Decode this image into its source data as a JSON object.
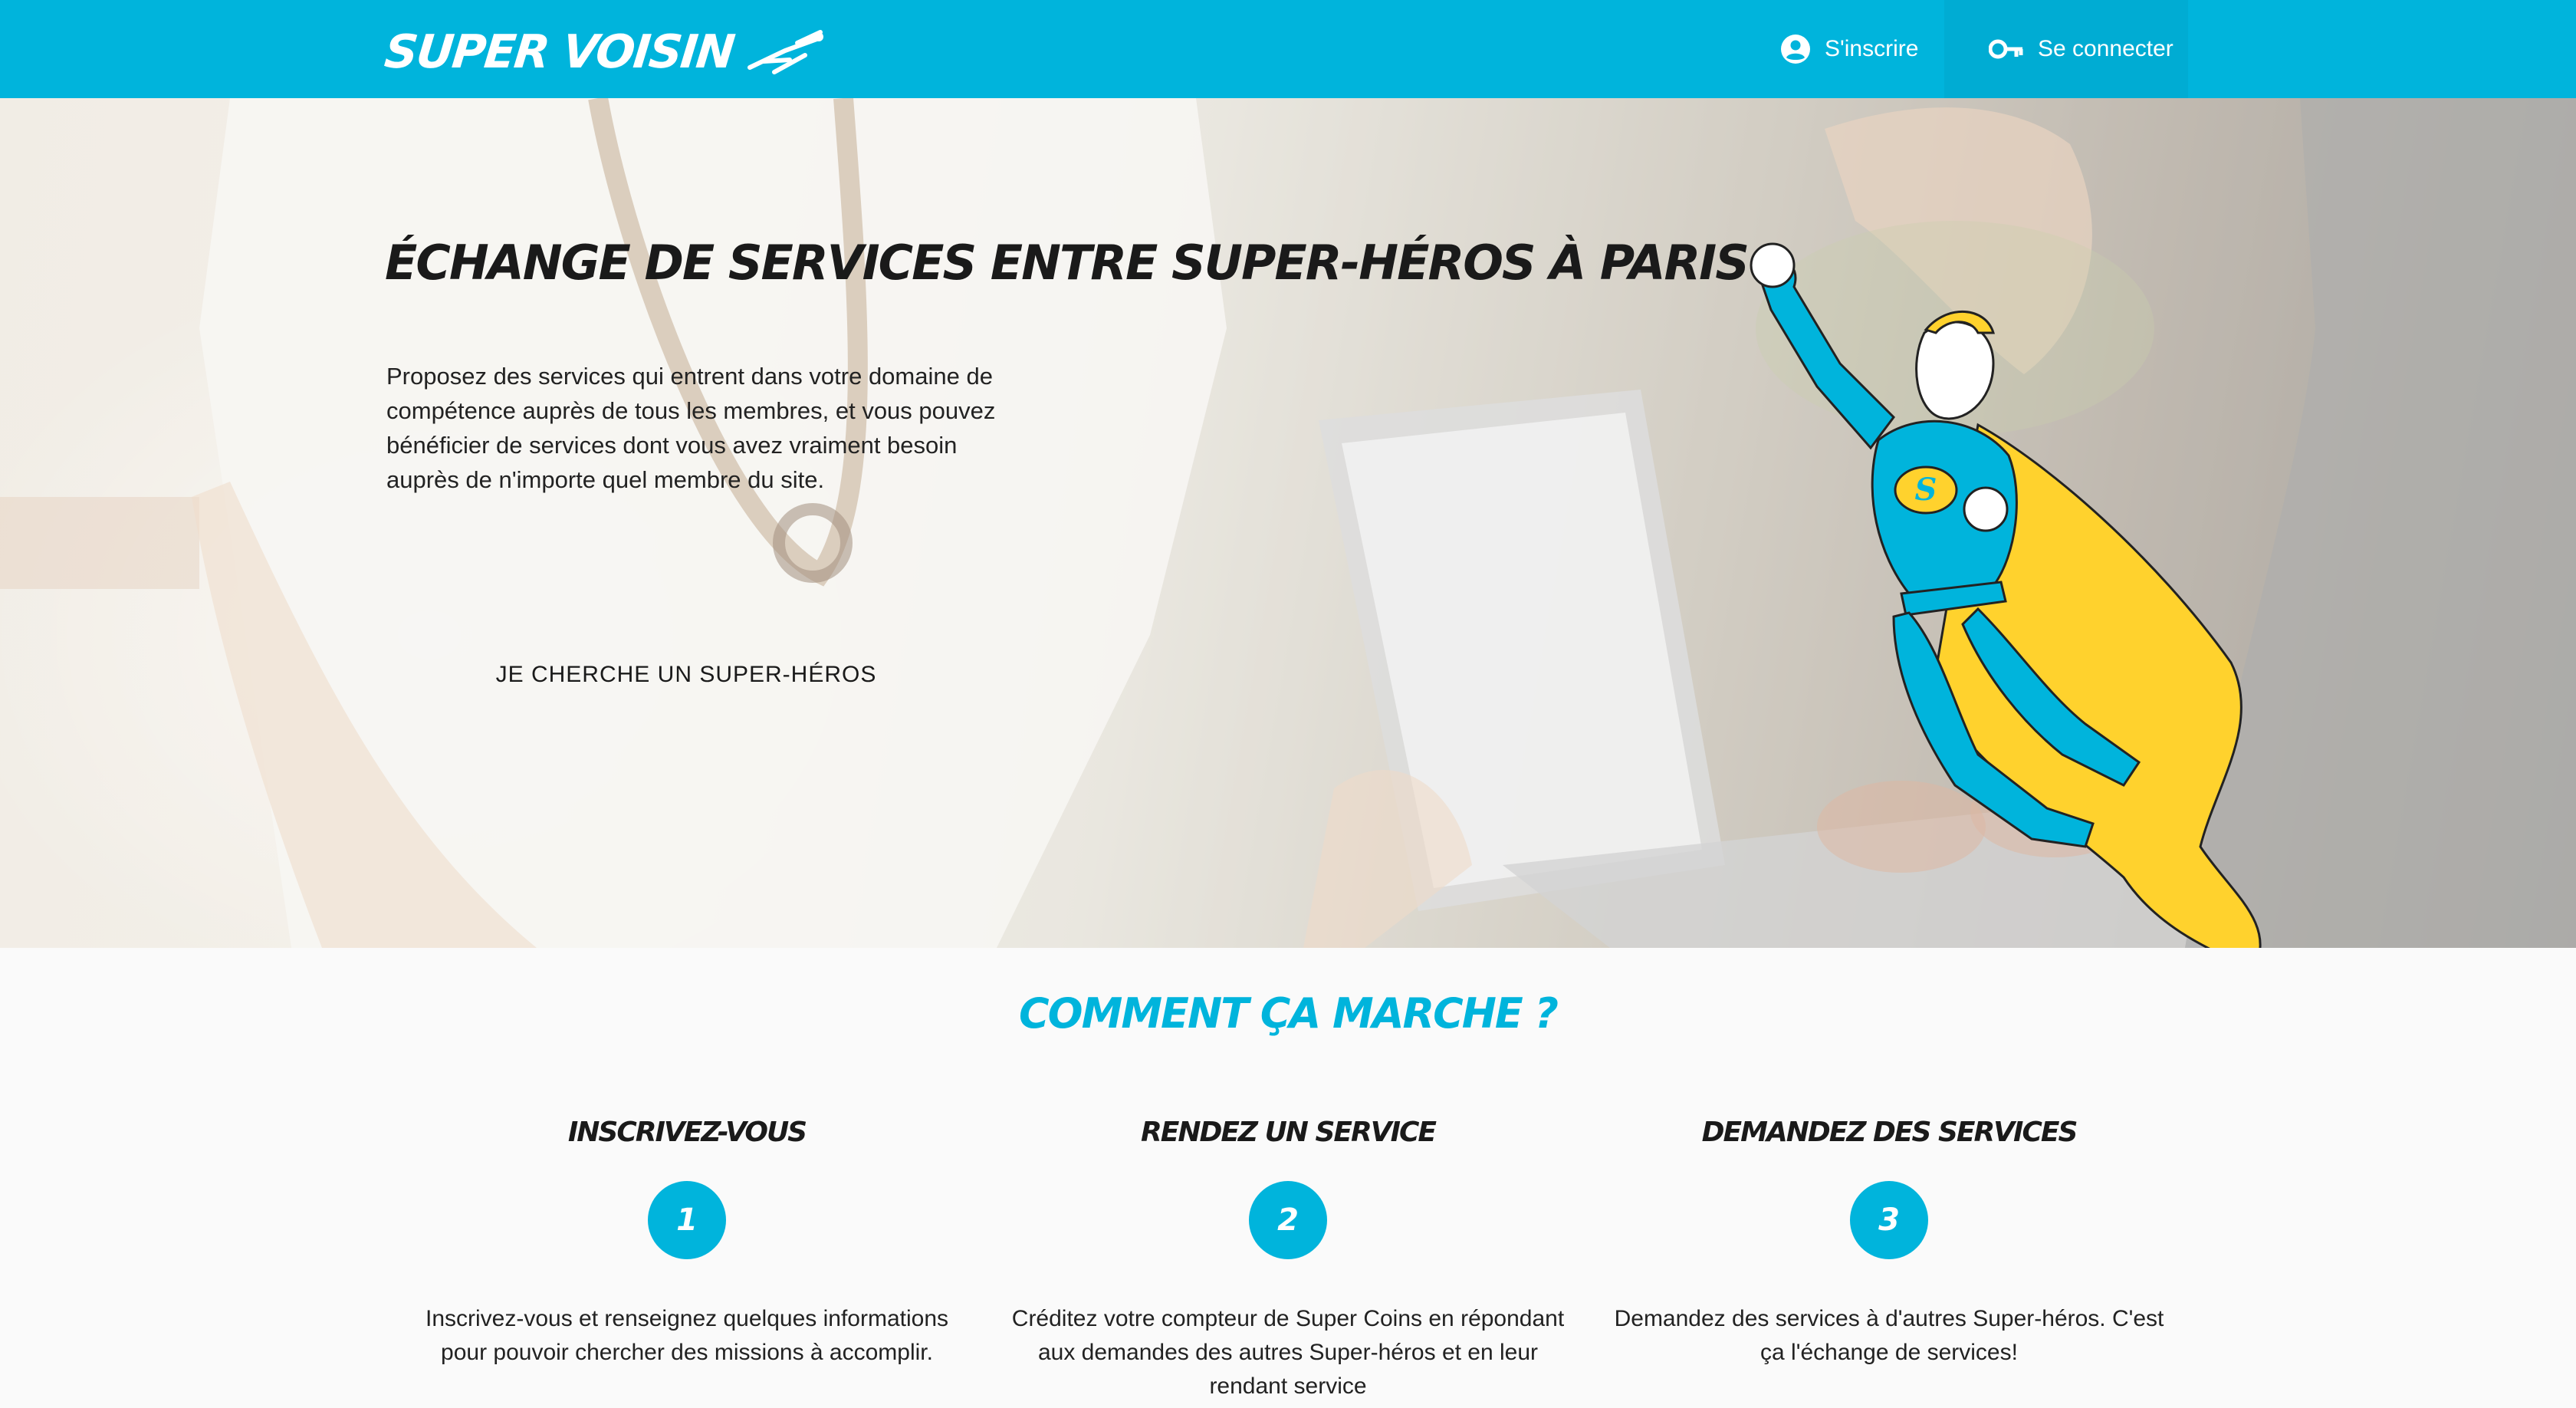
{
  "navbar": {
    "brand": "SUPER VOISIN",
    "register_label": "S'inscrire",
    "login_label": "Se connecter"
  },
  "hero": {
    "title": "ÉCHANGE DE SERVICES ENTRE SUPER-HÉROS À PARIS",
    "text": "Proposez des services qui entrent dans votre domaine de compétence auprès de tous les membres, et vous pouvez bénéficier de services dont vous avez vraiment besoin auprès de n'importe quel membre du site.",
    "cta_label": "JE CHERCHE UN SUPER-HÉROS"
  },
  "how": {
    "title": "COMMENT ÇA MARCHE ?",
    "steps": [
      {
        "title": "INSCRIVEZ-VOUS",
        "number": "1",
        "description": "Inscrivez-vous et renseignez quelques informations pour pouvoir chercher des missions à accomplir."
      },
      {
        "title": "RENDEZ UN SERVICE",
        "number": "2",
        "description": "Créditez votre compteur de Super Coins en répondant aux demandes des autres Super-héros et en leur rendant service"
      },
      {
        "title": "DEMANDEZ DES SERVICES",
        "number": "3",
        "description": "Demandez des services à d'autres Super-héros. C'est ça l'échange de services!"
      }
    ]
  },
  "colors": {
    "primary": "#00b4dc",
    "accent": "#ffd22d",
    "text": "#1a1a1a"
  },
  "icons": {
    "brand": "flying-hero-icon",
    "register": "user-circle-icon",
    "login": "key-icon"
  }
}
